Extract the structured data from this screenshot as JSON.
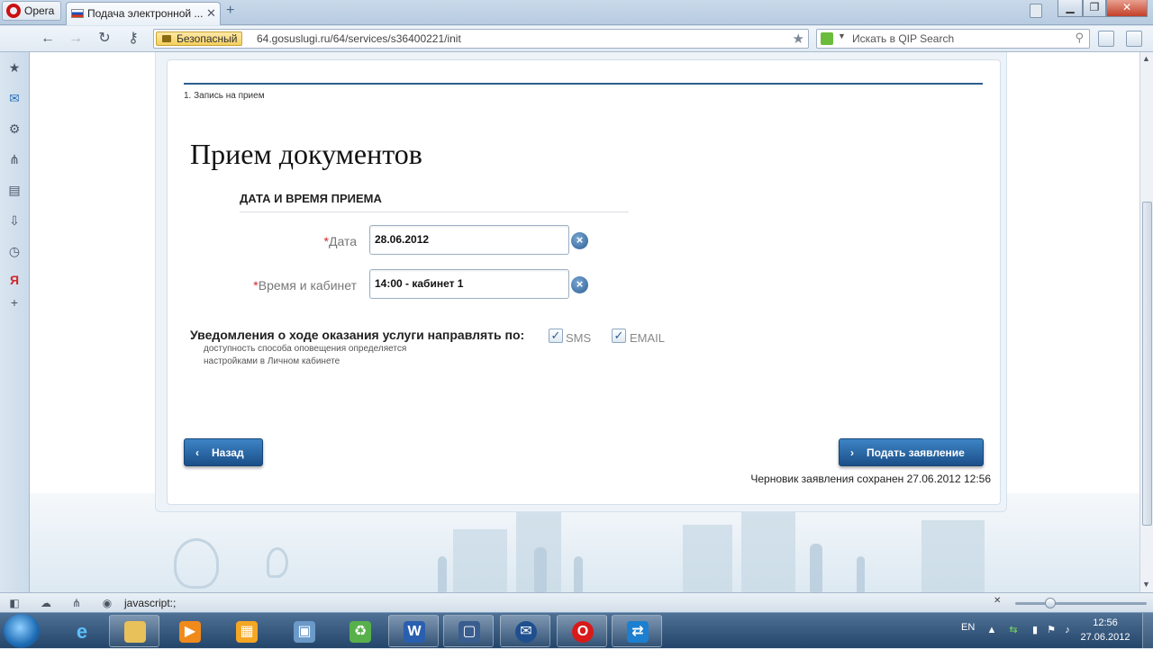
{
  "browser": {
    "menu_label": "Opera",
    "tab_title": "Подача электронной ...",
    "tab_close": "✕",
    "new_tab": "+",
    "security_label": "Безопасный",
    "url": "64.gosuslugi.ru/64/services/s36400221/init",
    "search_placeholder": "Искать в QIP Search",
    "status_text": "javascript:;"
  },
  "form": {
    "step_label": "1. Запись на прием",
    "heading": "Прием документов",
    "section_title": "ДАТА И ВРЕМЯ ПРИЕМА",
    "required_mark": "*",
    "date_label": "Дата",
    "date_value": "28.06.2012",
    "time_label": "Время и кабинет",
    "time_value": "14:00 - кабинет 1",
    "notify_title": "Уведомления о ходе оказания услуги направлять по:",
    "notify_hint": "доступность способа оповещения определяется настройками в Личном кабинете",
    "option_sms": "SMS",
    "option_email": "EMAIL",
    "sms_checked": true,
    "email_checked": true,
    "back_button": "Назад",
    "submit_button": "Подать заявление",
    "saved_text": "Черновик заявления сохранен 27.06.2012 12:56"
  },
  "taskbar": {
    "lang": "EN",
    "time": "12:56",
    "date": "27.06.2012",
    "apps": [
      "ie-icon",
      "explorer-icon",
      "media-player-icon",
      "paint-icon",
      "display-settings-icon",
      "recycle-tray-icon",
      "word-icon",
      "virtualbox-icon",
      "thunderbird-icon",
      "opera-icon",
      "teamviewer-icon"
    ]
  },
  "colors": {
    "accent": "#1b4f88",
    "rule": "#2d5f8e",
    "required": "#d0282a"
  }
}
